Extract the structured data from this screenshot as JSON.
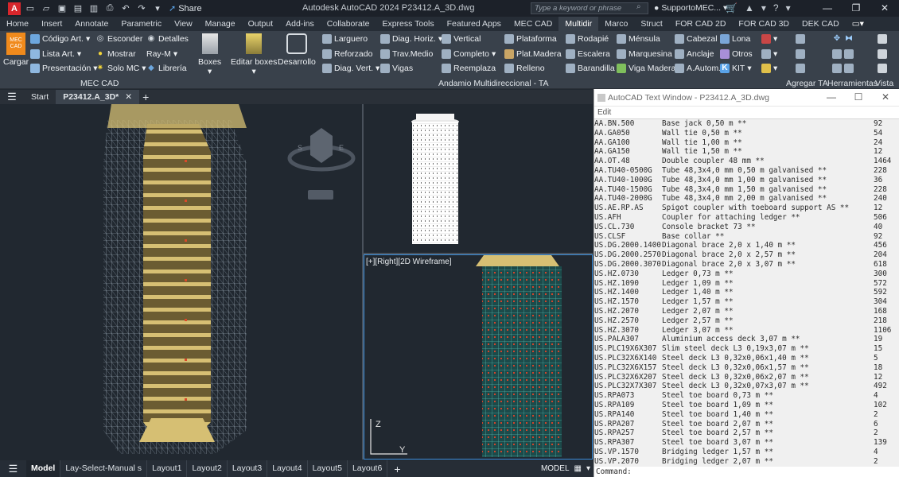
{
  "titlebar": {
    "app_letter": "A",
    "share_label": "Share",
    "window_title": "Autodesk AutoCAD 2024   P23412.A_3D.dwg",
    "search_placeholder": "Type a keyword or phrase",
    "user": "SupportoMEC..."
  },
  "ribbon_tabs": [
    "Home",
    "Insert",
    "Annotate",
    "Parametric",
    "View",
    "Manage",
    "Output",
    "Add-ins",
    "Collaborate",
    "Express Tools",
    "Featured Apps",
    "MEC CAD",
    "Multidir",
    "Marco",
    "Struct",
    "FOR CAD 2D",
    "FOR CAD 3D",
    "DEK CAD"
  ],
  "active_tab": "Multidir",
  "ribbon": {
    "cargar": "Cargar",
    "logo_text": "MEC CAD",
    "codigo_art": "Código Art.",
    "lista_art": "Lista Art.",
    "presentacion": "Presentación",
    "esconder": "Esconder",
    "mostrar": "Mostrar",
    "solo_mc": "Solo MC",
    "detalles": "Detalles",
    "ray_m": "Ray-M",
    "libreria": "Librería",
    "mec_cad_panel": "MEC CAD",
    "boxes": "Boxes",
    "editar_boxes": "Editar boxes",
    "desarrollo": "Desarrollo",
    "larguero": "Larguero",
    "reforzado": "Reforzado",
    "diag_vert": "Diag. Vert.",
    "diag_horiz": "Diag. Horiz.",
    "trav_medio": "Trav.Medio",
    "vigas": "Vigas",
    "vertical": "Vertical",
    "completo": "Completo",
    "reemplaza": "Reemplaza",
    "plataforma": "Plataforma",
    "plat_madera": "Plat.Madera",
    "relleno": "Relleno",
    "rodapie": "Rodapié",
    "escalera": "Escalera",
    "barandilla": "Barandilla",
    "mensula": "Ménsula",
    "marquesina": "Marquesina",
    "viga_madera": "Viga Madera",
    "cabezal": "Cabezal",
    "anclaje": "Anclaje",
    "a_autom": "A.Autom.",
    "lona": "Lona",
    "otros": "Otros",
    "kit": "KIT",
    "andamio_panel": "Andamio Multidireccional - TA",
    "agregar_ta": "Agregar TA",
    "herramientas": "Herramientas",
    "vista": "Vista"
  },
  "doc_tabs": {
    "start": "Start",
    "file": "P23412.A_3D*"
  },
  "viewport_right_label": "[+][Right][2D Wireframe]",
  "axis": {
    "x": "Y",
    "y": "Z"
  },
  "text_window": {
    "title": "AutoCAD Text Window - P23412.A_3D.dwg",
    "menu": "Edit",
    "command_prompt": "Command:",
    "rows": [
      [
        "AA.BN.500",
        "Base jack 0,50 m **",
        "92"
      ],
      [
        "AA.GA050",
        "Wall tie 0,50 m **",
        "54"
      ],
      [
        "AA.GA100",
        "Wall tie 1,00 m **",
        "24"
      ],
      [
        "AA.GA150",
        "Wall tie 1,50 m **",
        "12"
      ],
      [
        "AA.OT.48",
        "Double coupler 48 mm **",
        "1464"
      ],
      [
        "AA.TU40-0500G",
        "Tube 48,3x4,0 mm 0,50 m galvanised **",
        "228"
      ],
      [
        "AA.TU40-1000G",
        "Tube 48,3x4,0 mm 1,00 m galvanised **",
        "36"
      ],
      [
        "AA.TU40-1500G",
        "Tube 48,3x4,0 mm 1,50 m galvanised **",
        "228"
      ],
      [
        "AA.TU40-2000G",
        "Tube 48,3x4,0 mm 2,00 m galvanised **",
        "240"
      ],
      [
        "US.AE.RP.AS",
        "Spigot coupler with toeboard support AS **",
        "12"
      ],
      [
        "US.AFH",
        "Coupler for attaching ledger **",
        "506"
      ],
      [
        "US.CL.730",
        "Console bracket 73 **",
        "40"
      ],
      [
        "US.CLSF",
        "Base collar **",
        "92"
      ],
      [
        "US.DG.2000.1400",
        "Diagonal brace 2,0 x 1,40 m **",
        "456"
      ],
      [
        "US.DG.2000.2570",
        "Diagonal brace 2,0 x 2,57 m **",
        "204"
      ],
      [
        "US.DG.2000.3070",
        "Diagonal brace 2,0 x 3,07 m **",
        "618"
      ],
      [
        "US.HZ.0730",
        "Ledger 0,73 m **",
        "300"
      ],
      [
        "US.HZ.1090",
        "Ledger 1,09 m **",
        "572"
      ],
      [
        "US.HZ.1400",
        "Ledger 1,40 m **",
        "592"
      ],
      [
        "US.HZ.1570",
        "Ledger 1,57 m **",
        "304"
      ],
      [
        "US.HZ.2070",
        "Ledger 2,07 m **",
        "168"
      ],
      [
        "US.HZ.2570",
        "Ledger 2,57 m **",
        "218"
      ],
      [
        "US.HZ.3070",
        "Ledger 3,07 m **",
        "1106"
      ],
      [
        "US.PALA307",
        "Aluminium access deck 3,07 m **",
        "19"
      ],
      [
        "US.PLC19X6X307",
        "Slim steel deck L3 0,19x3,07 m **",
        "15"
      ],
      [
        "US.PLC32X6X140",
        "Steel deck L3 0,32x0,06x1,40 m **",
        "5"
      ],
      [
        "US.PLC32X6X157",
        "Steel deck L3 0,32x0,06x1,57 m **",
        "18"
      ],
      [
        "US.PLC32X6X207",
        "Steel deck L3 0,32x0,06x2,07 m **",
        "12"
      ],
      [
        "US.PLC32X7X307",
        "Steel deck L3 0,32x0,07x3,07 m **",
        "492"
      ],
      [
        "US.RPA073",
        "Steel toe board 0,73 m **",
        "4"
      ],
      [
        "US.RPA109",
        "Steel toe board 1,09 m **",
        "102"
      ],
      [
        "US.RPA140",
        "Steel toe board 1,40 m **",
        "2"
      ],
      [
        "US.RPA207",
        "Steel toe board 2,07 m **",
        "6"
      ],
      [
        "US.RPA257",
        "Steel toe board 2,57 m **",
        "2"
      ],
      [
        "US.RPA307",
        "Steel toe board 3,07 m **",
        "139"
      ],
      [
        "US.VP.1570",
        "Bridging ledger 1,57 m **",
        "4"
      ],
      [
        "US.VP.2070",
        "Bridging ledger 2,07 m **",
        "2"
      ]
    ]
  },
  "layout_tabs": [
    "Model",
    "Lay-Select-Manual s",
    "Layout1",
    "Layout2",
    "Layout3",
    "Layout4",
    "Layout5",
    "Layout6"
  ],
  "status": {
    "model": "MODEL"
  }
}
